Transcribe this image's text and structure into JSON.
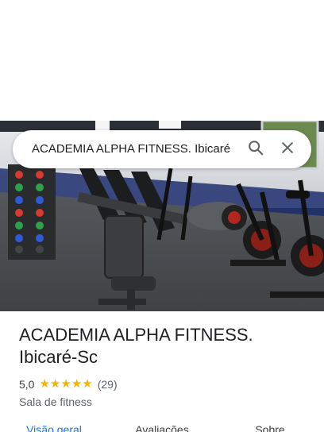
{
  "search": {
    "query": "ACADEMIA ALPHA FITNESS. Ibicaré",
    "search_icon": "search-icon",
    "close_icon": "close-icon"
  },
  "place": {
    "title": "ACADEMIA ALPHA FITNESS. Ibicaré-Sc",
    "rating": "5,0",
    "stars": 5,
    "review_count": "(29)",
    "category": "Sala de fitness"
  },
  "tabs": [
    {
      "label": "Visão geral",
      "active": true
    },
    {
      "label": "Avaliações",
      "active": false
    },
    {
      "label": "Sobre",
      "active": false
    }
  ],
  "colors": {
    "accent": "#1a73e8",
    "star": "#f6b400",
    "text": "#202124",
    "muted": "#5f6368"
  }
}
